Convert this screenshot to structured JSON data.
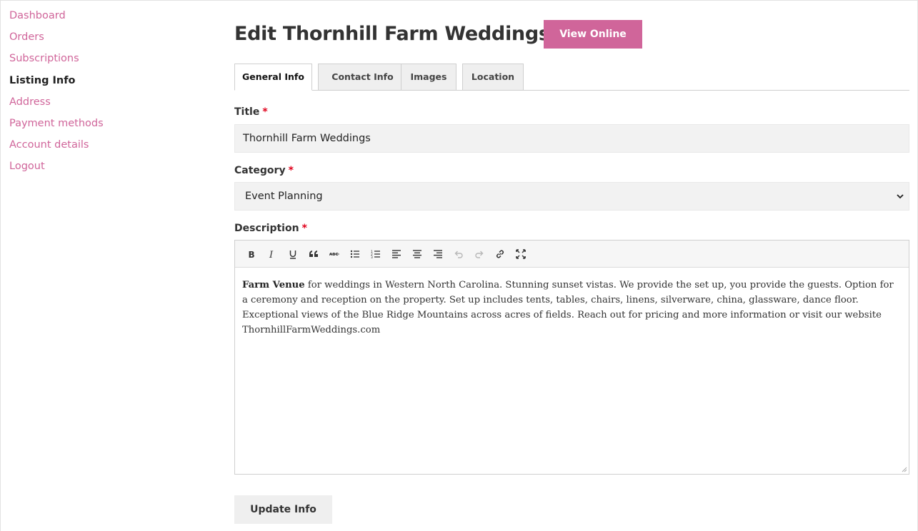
{
  "sidebar": {
    "items": [
      {
        "label": "Dashboard"
      },
      {
        "label": "Orders"
      },
      {
        "label": "Subscriptions"
      },
      {
        "label": "Listing Info"
      },
      {
        "label": "Address"
      },
      {
        "label": "Payment methods"
      },
      {
        "label": "Account details"
      },
      {
        "label": "Logout"
      }
    ],
    "active_index": 3
  },
  "header": {
    "title": "Edit Thornhill Farm Weddings",
    "view_online_label": "View Online"
  },
  "tabs": [
    {
      "label": "General Info"
    },
    {
      "label": "Contact Info"
    },
    {
      "label": "Images"
    },
    {
      "label": "Location"
    }
  ],
  "form": {
    "title_label": "Title",
    "title_value": "Thornhill Farm Weddings",
    "category_label": "Category",
    "category_value": "Event Planning",
    "description_label": "Description",
    "required_mark": "*",
    "description_bold": "Farm Venue",
    "description_text": " for weddings in Western North Carolina. Stunning sunset vistas. We provide the set up, you provide the guests. Option for a ceremony and reception on the property. Set up includes tents, tables, chairs, linens, silverware, china, glassware, dance floor. Exceptional views of the Blue Ridge Mountains across acres of fields. Reach out for pricing and more information or visit our website ThornhillFarmWeddings.com",
    "update_label": "Update Info"
  },
  "toolbar_icons": [
    "bold-icon",
    "italic-icon",
    "underline-icon",
    "blockquote-icon",
    "strikethrough-icon",
    "bullet-list-icon",
    "numbered-list-icon",
    "align-left-icon",
    "align-center-icon",
    "align-right-icon",
    "undo-icon",
    "redo-icon",
    "link-icon",
    "fullscreen-icon"
  ],
  "colors": {
    "accent": "#d0659a",
    "required": "#e0001b",
    "input_bg": "#f2f2f2"
  }
}
